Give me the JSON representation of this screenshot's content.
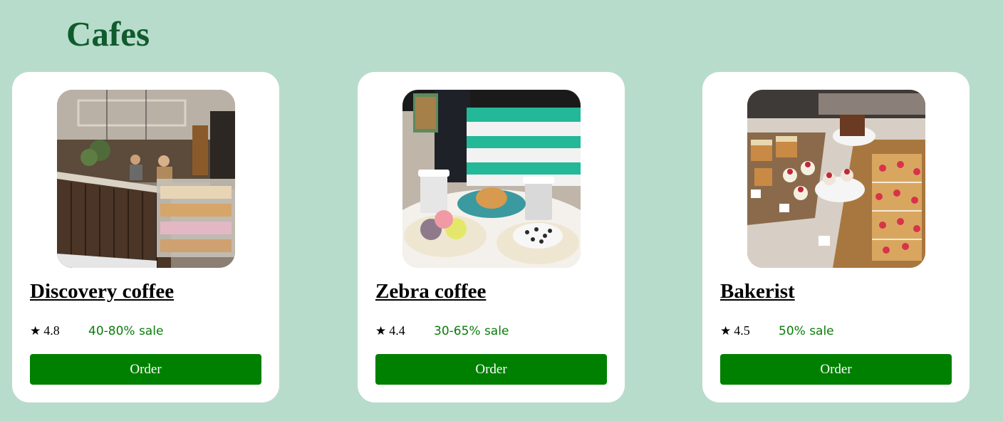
{
  "page": {
    "title": "Cafes"
  },
  "colors": {
    "background": "#b8dccb",
    "title": "#0f5b2e",
    "card": "#ffffff",
    "sale_text": "#0a7d0a",
    "button": "#008000",
    "button_text": "#ffffff"
  },
  "cafes": [
    {
      "name": "Discovery coffee",
      "rating": "4.8",
      "rating_icon": "star-icon",
      "sale": "40-80% sale",
      "button_label": "Order",
      "photo_subject": "cafe interior with pastry display counter"
    },
    {
      "name": "Zebra coffee",
      "rating": "4.4",
      "rating_icon": "star-icon",
      "sale": "30-65% sale",
      "button_label": "Order",
      "photo_subject": "coffee cups and desserts in front of striped kiosk"
    },
    {
      "name": "Bakerist",
      "rating": "4.5",
      "rating_icon": "star-icon",
      "sale": "50% sale",
      "button_label": "Order",
      "photo_subject": "bakery display case with cakes"
    }
  ]
}
